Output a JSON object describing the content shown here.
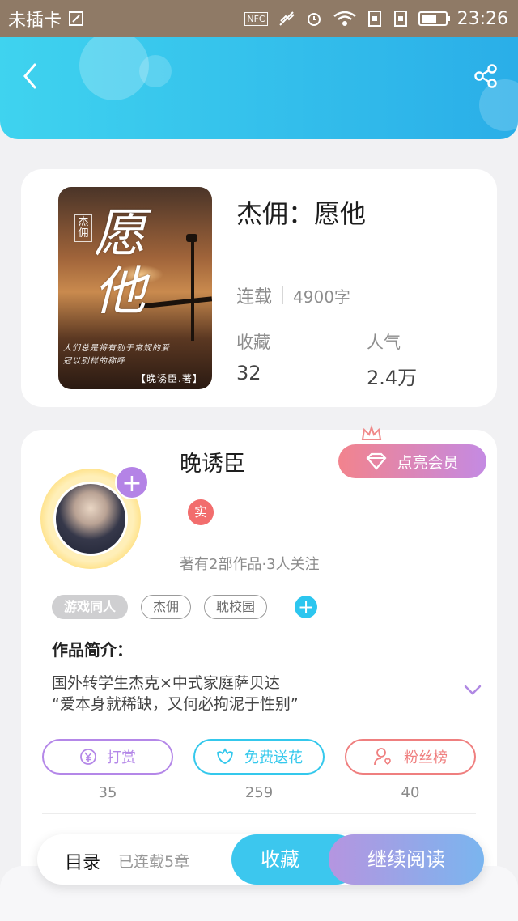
{
  "status_bar": {
    "carrier": "未插卡",
    "nfc": "NFC",
    "time": "23:26",
    "icons": [
      "sim-icon",
      "nfc-icon",
      "mute-icon",
      "alarm-icon",
      "wifi-icon",
      "card-icon",
      "card-icon",
      "battery-icon"
    ]
  },
  "header": {
    "back_icon": "chevron-left-icon",
    "share_icon": "share-icon",
    "colors": {
      "from": "#3fd3ef",
      "to": "#2aaee8"
    }
  },
  "book": {
    "cover": {
      "small_tag": "杰佣",
      "big_title": "愿他",
      "line1": "人们总是将有别于常规的爱",
      "line2": "冠以别样的称呼",
      "author": "【晚诱臣.著】"
    },
    "title": "杰佣：愿他",
    "status": "连载",
    "words": "4900字",
    "stats": [
      {
        "label": "收藏",
        "value": "32"
      },
      {
        "label": "人气",
        "value": "2.4万"
      }
    ]
  },
  "author": {
    "name": "晚诱臣",
    "verified": "实",
    "meta": "著有2部作品·3人关注",
    "vip_label": "点亮会员",
    "tags": [
      "游戏同人",
      "杰佣",
      "耽校园"
    ]
  },
  "intro": {
    "title": "作品简介：",
    "lines": [
      "国外转学生杰克×中式家庭萨贝达",
      "“爱本身就稀缺，又何必拘泥于性别”"
    ]
  },
  "actions": [
    {
      "label": "打赏",
      "count": "35",
      "icon": "yen-icon"
    },
    {
      "label": "免费送花",
      "count": "259",
      "icon": "flower-icon"
    },
    {
      "label": "粉丝榜",
      "count": "40",
      "icon": "fans-icon"
    }
  ],
  "bottom": {
    "toc": "目录",
    "toc_sub": "已连载5章",
    "favorite": "收藏",
    "continue": "继续阅读"
  }
}
